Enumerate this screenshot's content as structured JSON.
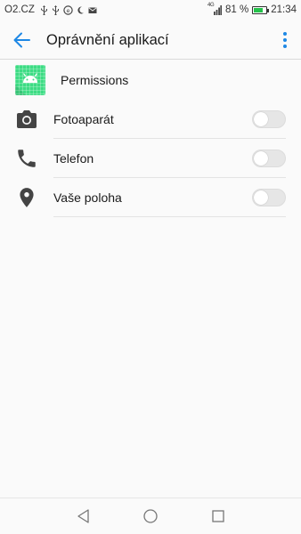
{
  "status_bar": {
    "carrier": "O2.CZ",
    "network_type": "4G",
    "battery": "81 %",
    "battery_level": 0.81,
    "time": "21:34",
    "battery_color": "#24c24a"
  },
  "app_bar": {
    "title": "Oprávnění aplikací",
    "accent_color": "#1e88e5"
  },
  "app": {
    "name": "Permissions",
    "icon": "android-icon",
    "icon_color": "#3ddc84"
  },
  "permissions": [
    {
      "label": "Fotoaparát",
      "icon": "camera-icon",
      "enabled": false
    },
    {
      "label": "Telefon",
      "icon": "phone-icon",
      "enabled": false
    },
    {
      "label": "Vaše poloha",
      "icon": "location-icon",
      "enabled": false
    }
  ],
  "nav_bar": {
    "buttons": [
      "back-icon",
      "home-icon",
      "recents-icon"
    ]
  }
}
